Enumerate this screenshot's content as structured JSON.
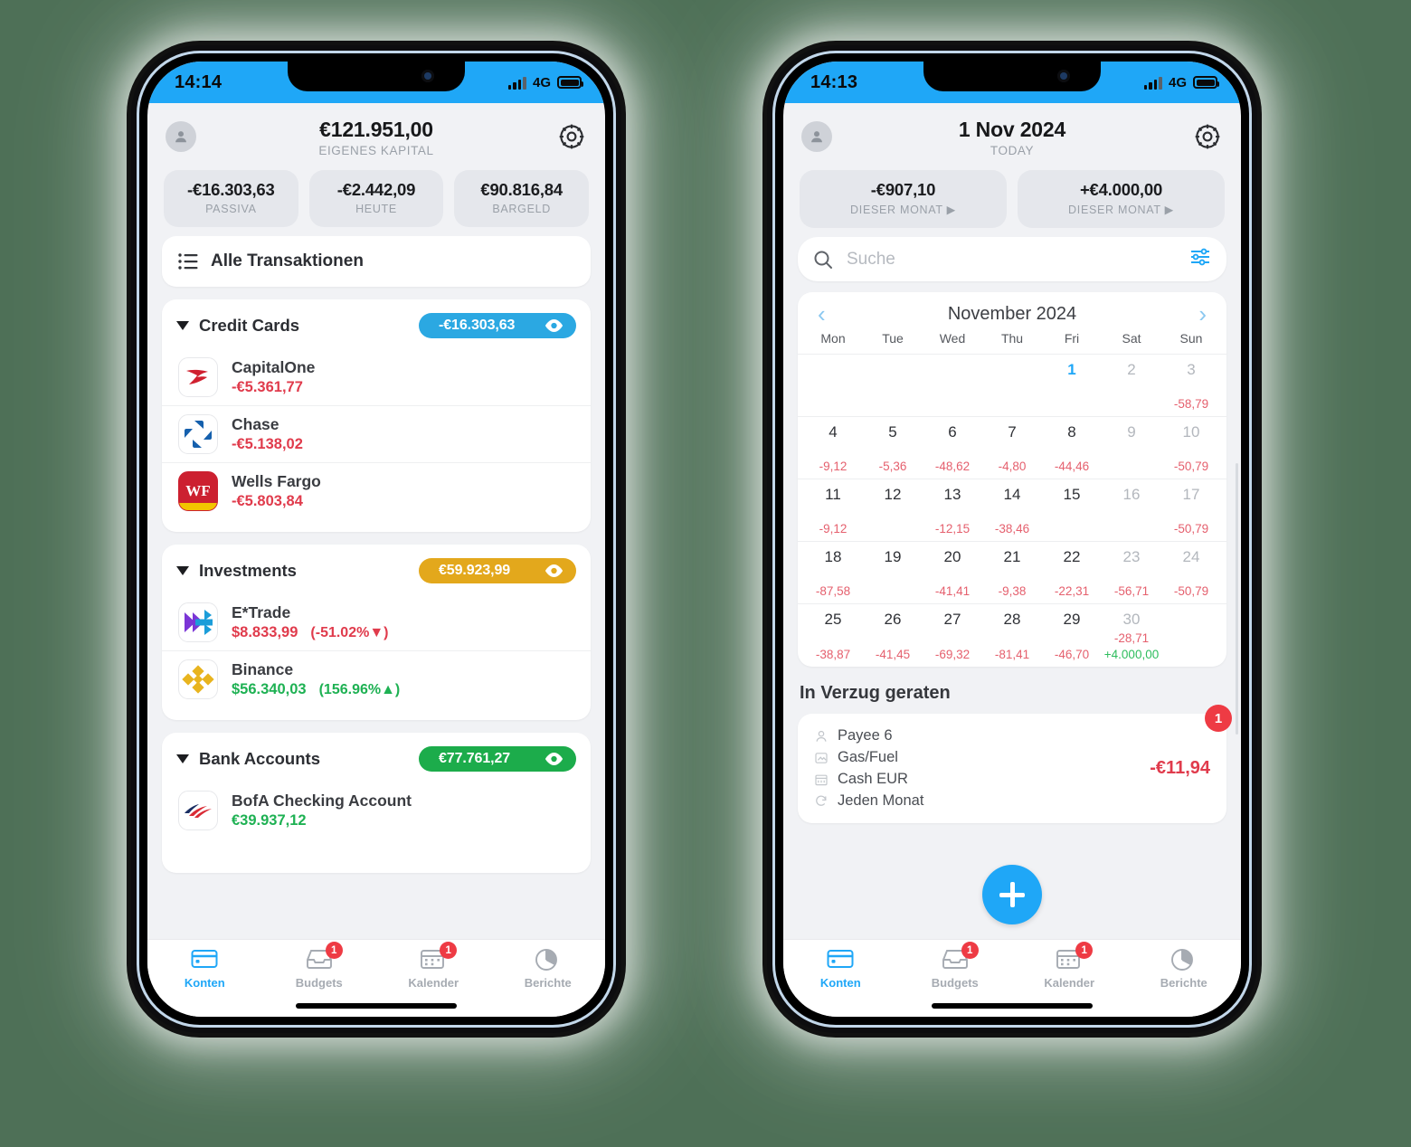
{
  "background_color": "#4e7057",
  "accent": {
    "blue": "#1fa7f7",
    "badge_blue": "#2ba8e2",
    "badge_amber": "#e3a81c",
    "badge_green": "#1cac4b",
    "negative": "#e03b4c",
    "positive": "#1eb153",
    "notification_red": "#ee3b44"
  },
  "phone_left": {
    "status_bar": {
      "time": "14:14",
      "network": "4G",
      "signal_icon": "signal-bars-icon",
      "battery_icon": "battery-icon"
    },
    "header": {
      "avatar_icon": "person-avatar-icon",
      "amount": "€121.951,00",
      "label": "EIGENES KAPITAL",
      "settings_icon": "gear-icon"
    },
    "chips": [
      {
        "amount": "-€16.303,63",
        "label": "PASSIVA"
      },
      {
        "amount": "-€2.442,09",
        "label": "HEUTE"
      },
      {
        "amount": "€90.816,84",
        "label": "BARGELD"
      }
    ],
    "all_transactions": {
      "icon": "list-icon",
      "label": "Alle Transaktionen"
    },
    "sections": [
      {
        "name": "Credit Cards",
        "caret_icon": "caret-down-icon",
        "badge_amount": "-€16.303,63",
        "badge_color": "#2ba8e2",
        "eye_icon": "eye-icon",
        "accounts": [
          {
            "icon": "capitalone-logo-icon",
            "name": "CapitalOne",
            "balance": "-€5.361,77",
            "balance_sign": "negative",
            "change": ""
          },
          {
            "icon": "chase-logo-icon",
            "name": "Chase",
            "balance": "-€5.138,02",
            "balance_sign": "negative",
            "change": ""
          },
          {
            "icon": "wellsfargo-logo-icon",
            "name": "Wells Fargo",
            "balance": "-€5.803,84",
            "balance_sign": "negative",
            "change": ""
          }
        ]
      },
      {
        "name": "Investments",
        "caret_icon": "caret-down-icon",
        "badge_amount": "€59.923,99",
        "badge_color": "#e3a81c",
        "eye_icon": "eye-icon",
        "accounts": [
          {
            "icon": "etrade-logo-icon",
            "name": "E*Trade",
            "balance": "$8.833,99",
            "balance_sign": "negative",
            "change": "(-51.02%▼)",
            "change_sign": "negative"
          },
          {
            "icon": "binance-logo-icon",
            "name": "Binance",
            "balance": "$56.340,03",
            "balance_sign": "positive",
            "change": "(156.96%▲)",
            "change_sign": "positive"
          }
        ]
      },
      {
        "name": "Bank Accounts",
        "caret_icon": "caret-down-icon",
        "badge_amount": "€77.761,27",
        "badge_color": "#1cac4b",
        "eye_icon": "eye-icon",
        "accounts": [
          {
            "icon": "bofa-logo-icon",
            "name": "BofA Checking Account",
            "balance": "€39.937,12",
            "balance_sign": "positive",
            "change": ""
          }
        ]
      }
    ],
    "tabs": [
      {
        "label": "Konten",
        "icon": "credit-card-icon",
        "active": true,
        "badge": ""
      },
      {
        "label": "Budgets",
        "icon": "inbox-tray-icon",
        "active": false,
        "badge": "1"
      },
      {
        "label": "Kalender",
        "icon": "calendar-icon",
        "active": false,
        "badge": "1"
      },
      {
        "label": "Berichte",
        "icon": "pie-chart-icon",
        "active": false,
        "badge": ""
      }
    ]
  },
  "phone_right": {
    "status_bar": {
      "time": "14:13",
      "network": "4G",
      "signal_icon": "signal-bars-icon",
      "battery_icon": "battery-icon"
    },
    "header": {
      "avatar_icon": "person-avatar-icon",
      "date": "1 Nov 2024",
      "label": "TODAY",
      "settings_icon": "gear-icon"
    },
    "chips": [
      {
        "amount": "-€907,10",
        "label": "DIESER MONAT ▶"
      },
      {
        "amount": "+€4.000,00",
        "label": "DIESER MONAT ▶"
      }
    ],
    "search": {
      "placeholder": "Suche",
      "value": "",
      "search_icon": "search-icon",
      "filter_icon": "sliders-filter-icon"
    },
    "calendar": {
      "title": "November 2024",
      "prev_icon": "chevron-left-icon",
      "next_icon": "chevron-right-icon",
      "day_names": [
        "Mon",
        "Tue",
        "Wed",
        "Thu",
        "Fri",
        "Sat",
        "Sun"
      ],
      "weeks": [
        [
          {
            "day": "",
            "value": ""
          },
          {
            "day": "",
            "value": ""
          },
          {
            "day": "",
            "value": ""
          },
          {
            "day": "",
            "value": ""
          },
          {
            "day": "1",
            "value": "",
            "today": true
          },
          {
            "day": "2",
            "value": "",
            "dim": true
          },
          {
            "day": "3",
            "value": "-58,79",
            "dim": true
          }
        ],
        [
          {
            "day": "4",
            "value": "-9,12"
          },
          {
            "day": "5",
            "value": "-5,36"
          },
          {
            "day": "6",
            "value": "-48,62"
          },
          {
            "day": "7",
            "value": "-4,80"
          },
          {
            "day": "8",
            "value": "-44,46"
          },
          {
            "day": "9",
            "value": "",
            "dim": true
          },
          {
            "day": "10",
            "value": "-50,79",
            "dim": true
          }
        ],
        [
          {
            "day": "11",
            "value": "-9,12"
          },
          {
            "day": "12",
            "value": ""
          },
          {
            "day": "13",
            "value": "-12,15"
          },
          {
            "day": "14",
            "value": "-38,46"
          },
          {
            "day": "15",
            "value": ""
          },
          {
            "day": "16",
            "value": "",
            "dim": true
          },
          {
            "day": "17",
            "value": "-50,79",
            "dim": true
          }
        ],
        [
          {
            "day": "18",
            "value": "-87,58"
          },
          {
            "day": "19",
            "value": ""
          },
          {
            "day": "20",
            "value": "-41,41"
          },
          {
            "day": "21",
            "value": "-9,38"
          },
          {
            "day": "22",
            "value": "-22,31"
          },
          {
            "day": "23",
            "value": "-56,71",
            "dim": true
          },
          {
            "day": "24",
            "value": "-50,79",
            "dim": true
          }
        ],
        [
          {
            "day": "25",
            "value": "-38,87"
          },
          {
            "day": "26",
            "value": "-41,45"
          },
          {
            "day": "27",
            "value": "-69,32"
          },
          {
            "day": "28",
            "value": "-81,41"
          },
          {
            "day": "29",
            "value": "-46,70"
          },
          {
            "day": "30",
            "value": "-28,71",
            "value2": "+4.000,00",
            "value2_sign": "positive",
            "dim": true
          },
          {
            "day": "",
            "value": ""
          }
        ]
      ]
    },
    "overdue": {
      "title": "In Verzug geraten",
      "item": {
        "payee": "Payee 6",
        "payee_icon": "person-icon",
        "category": "Gas/Fuel",
        "category_icon": "tag-icon",
        "account": "Cash EUR",
        "account_icon": "wallet-icon",
        "recurrence": "Jeden Monat",
        "recurrence_icon": "repeat-icon",
        "amount": "-€11,94",
        "badge": "1"
      }
    },
    "fab": {
      "icon": "plus-icon",
      "label": "+"
    },
    "tabs": [
      {
        "label": "Konten",
        "icon": "credit-card-icon",
        "active": true,
        "badge": ""
      },
      {
        "label": "Budgets",
        "icon": "inbox-tray-icon",
        "active": false,
        "badge": "1"
      },
      {
        "label": "Kalender",
        "icon": "calendar-icon",
        "active": false,
        "badge": "1"
      },
      {
        "label": "Berichte",
        "icon": "pie-chart-icon",
        "active": false,
        "badge": ""
      }
    ]
  }
}
